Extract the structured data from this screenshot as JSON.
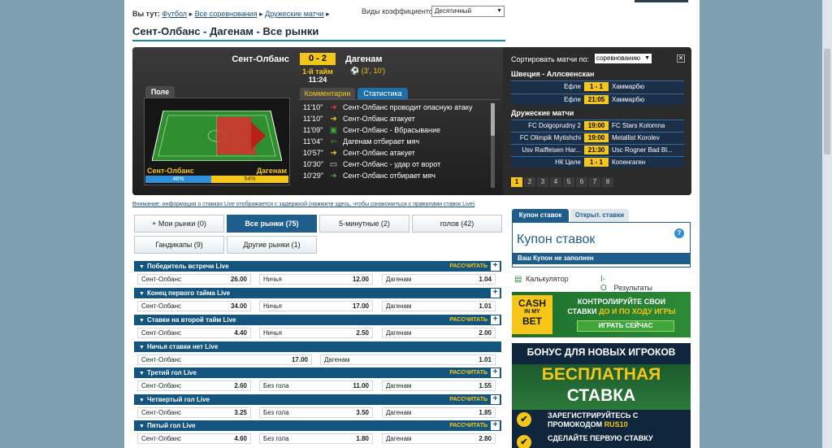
{
  "breadcrumb": {
    "prefix": "Вы тут:",
    "items": [
      "Футбол",
      "Все соревнования",
      "Дружеские матчи"
    ],
    "sep": "▸"
  },
  "odds": {
    "label": "Виды коэффициентов :",
    "value": "Десятичный"
  },
  "page_title": "Сент-Олбанс - Дагенам - Все рынки",
  "live": {
    "home": "Сент-Олбанс",
    "away": "Дагенам",
    "score": "0 - 2",
    "half": "1-й тайм",
    "time": "11:24",
    "goals": "(3', 10')",
    "field_tab": "Поле",
    "possession": {
      "home_pct": 46,
      "away_pct": 54,
      "home_label": "46%",
      "away_label": "54%"
    },
    "tabs": {
      "comments": "Комментарии",
      "stats": "Статистика"
    },
    "comments": [
      {
        "time": "11'10\"",
        "icon": "arrow-red",
        "text": "Сент-Олбанс проводит опасную атаку"
      },
      {
        "time": "11'10\"",
        "icon": "arrow-yellow",
        "text": "Сент-Олбанс атакует"
      },
      {
        "time": "11'09\"",
        "icon": "throw-in",
        "text": "Сент-Олбанс - Вбрасывание"
      },
      {
        "time": "11'04\"",
        "icon": "arrow-green-left",
        "text": "Дагенам отбирает мяч"
      },
      {
        "time": "10'57\"",
        "icon": "arrow-yellow",
        "text": "Сент-Олбанс атакует"
      },
      {
        "time": "10'30\"",
        "icon": "shot",
        "text": "Сент-Олбанс - удар от ворот"
      },
      {
        "time": "10'29\"",
        "icon": "arrow-green",
        "text": "Сент-Олбанс отбирает мяч"
      }
    ]
  },
  "sidebar_matches": {
    "sort_label": "Сортировать матчи по:",
    "sort_value": "соревнованию",
    "leagues": [
      {
        "name": "Швеция - Аллсвенскан",
        "matches": [
          {
            "home": "Ефле",
            "score": "1 - 1",
            "away": "Хаммарбю"
          },
          {
            "home": "Ефле",
            "score": "21:05",
            "away": "Хаммарбю"
          }
        ]
      },
      {
        "name": "Дружеские матчи",
        "matches": [
          {
            "home": "FC Dolgoprudny 2",
            "score": "19:00",
            "away": "FC Stars Kolomna"
          },
          {
            "home": "FC Olimpik Mytishchi",
            "score": "19:00",
            "away": "Metallist Korolev"
          },
          {
            "home": "Usv Raiffeisen Har...",
            "score": "21:30",
            "away": "Usc Rogner Bad Bl..."
          },
          {
            "home": "НК Целе",
            "score": "1 - 1",
            "away": "Копенгаген"
          }
        ]
      }
    ],
    "pages": [
      "1",
      "2",
      "3",
      "4",
      "5",
      "6",
      "7",
      "8"
    ]
  },
  "notice": "Внимание: информация о ставках Live отображается с задержкой (нажмите здесь, чтобы ознакомиться с правилами ставок Live)",
  "filters": [
    {
      "label": "+ Мои рынки (0)"
    },
    {
      "label": "Все рынки (75)"
    },
    {
      "label": "5-минутные (2)"
    },
    {
      "label": "голов (42)"
    },
    {
      "label": "Гандикапы (9)"
    },
    {
      "label": "Другие рынки (1)"
    }
  ],
  "calc_label": "РАССЧИТАТЬ",
  "markets": [
    {
      "title": "Победитель встречи Live",
      "calc": true,
      "cells": [
        {
          "name": "Сент-Олбанс",
          "odd": "26.00"
        },
        {
          "name": "Ничья",
          "odd": "12.00"
        },
        {
          "name": "Дагенам",
          "odd": "1.04"
        }
      ]
    },
    {
      "title": "Конец первого тайма Live",
      "calc": false,
      "cells": [
        {
          "name": "Сент-Олбанс",
          "odd": "34.00"
        },
        {
          "name": "Ничья",
          "odd": "17.00"
        },
        {
          "name": "Дагенам",
          "odd": "1.01"
        }
      ]
    },
    {
      "title": "Ставки на второй тайм Live",
      "calc": true,
      "cells": [
        {
          "name": "Сент-Олбанс",
          "odd": "4.40"
        },
        {
          "name": "Ничья",
          "odd": "2.50"
        },
        {
          "name": "Дагенам",
          "odd": "2.00"
        }
      ]
    },
    {
      "title": "Ничья ставки нет Live",
      "calc": false,
      "cells": [
        {
          "name": "Сент-Олбанс",
          "odd": "17.00"
        },
        {
          "name": "Дагенам",
          "odd": "1.01"
        }
      ]
    },
    {
      "title": "Третий гол Live",
      "calc": true,
      "cells": [
        {
          "name": "Сент-Олбанс",
          "odd": "2.60"
        },
        {
          "name": "Без гола",
          "odd": "11.00"
        },
        {
          "name": "Дагенам",
          "odd": "1.55"
        }
      ]
    },
    {
      "title": "Четвертый гол Live",
      "calc": true,
      "cells": [
        {
          "name": "Сент-Олбанс",
          "odd": "3.25"
        },
        {
          "name": "Без гола",
          "odd": "3.50"
        },
        {
          "name": "Дагенам",
          "odd": "1.85"
        }
      ]
    },
    {
      "title": "Пятый гол Live",
      "calc": true,
      "cells": [
        {
          "name": "Сент-Олбанс",
          "odd": "4.60"
        },
        {
          "name": "Без гола",
          "odd": "1.80"
        },
        {
          "name": "Дагенам",
          "odd": "2.80"
        }
      ]
    }
  ],
  "coupon": {
    "tab_active": "Купон ставок",
    "tab_other": "Открыт. ставки",
    "title": "Купон ставок",
    "help": "?",
    "empty": "Ваш Купон не заполнен",
    "calculator": "Калькулятор",
    "results": "Результаты"
  },
  "banner_cash": {
    "logo_1": "CASH",
    "logo_2": "IN MY",
    "logo_3": "BET",
    "line1": "КОНТРОЛИРУЙТЕ СВОИ",
    "line2_a": "СТАВКИ ",
    "line2_b": "ДО И ПО ХОДУ ИГРЫ",
    "button": "ИГРАТЬ СЕЙЧАС"
  },
  "banner_bonus": {
    "title": "БОНУС ДЛЯ НОВЫХ ИГРОКОВ",
    "free_1": "БЕСПЛАТНАЯ",
    "free_2": "СТАВКА",
    "step1_a": "ЗАРЕГИСТРИРУЙТЕСЬ С",
    "step1_b": "ПРОМОКОДОМ ",
    "step1_code": "RUS10",
    "step2": "СДЕЛАЙТЕ ПЕРВУЮ СТАВКУ"
  },
  "colors": {
    "accent": "#1f5d8c",
    "yellow": "#f5c518",
    "teal": "#0d8fa8",
    "dark": "#2b2b2b"
  }
}
